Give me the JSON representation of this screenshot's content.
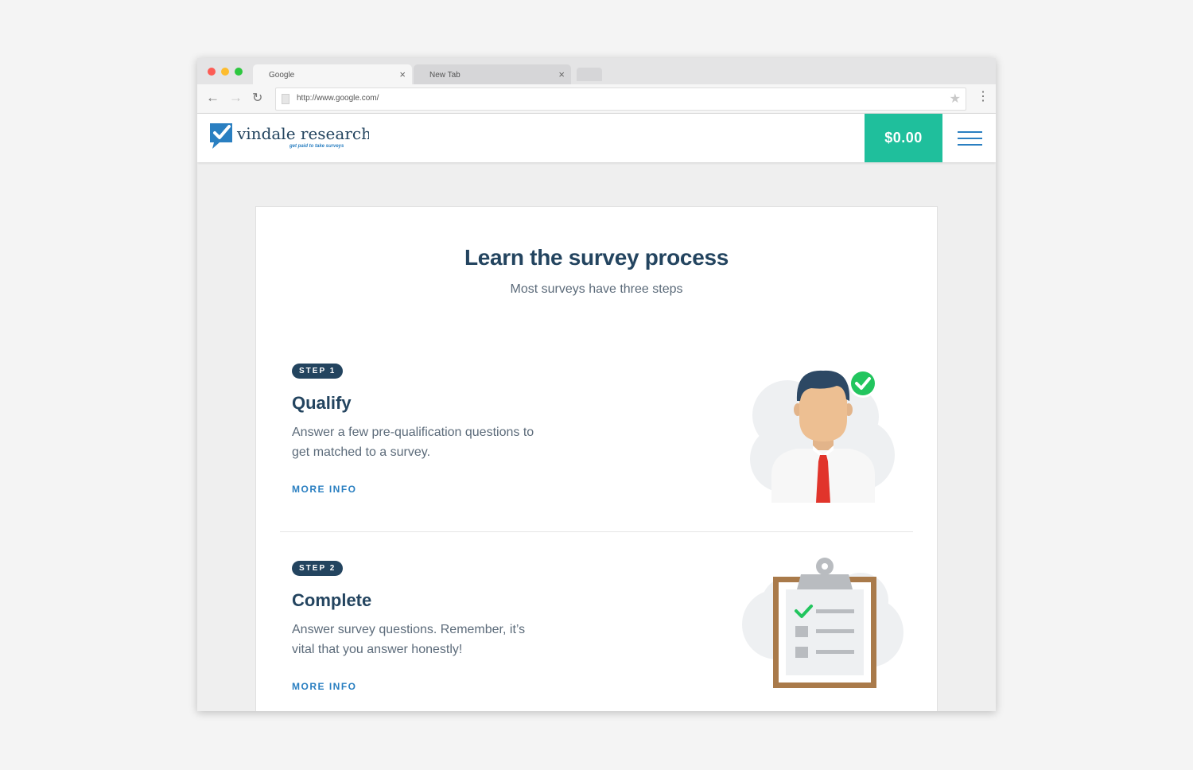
{
  "browser": {
    "tabs": [
      {
        "title": "Google",
        "close": "×"
      },
      {
        "title": "New Tab",
        "close": "×"
      }
    ],
    "url": "http://www.google.com/",
    "icons": {
      "back": "arrow-left-icon",
      "forward": "arrow-right-icon",
      "reload": "reload-icon",
      "bookmark": "star-icon",
      "menu": "kebab-menu-icon"
    }
  },
  "header": {
    "logo_name": "vindale research",
    "logo_tagline": "get paid to take surveys",
    "balance": "$0.00"
  },
  "main": {
    "title": "Learn the survey process",
    "subtitle": "Most surveys have three steps",
    "steps": [
      {
        "badge": "STEP 1",
        "title": "Qualify",
        "description": "Answer a few pre-qualification questions to get matched to a survey.",
        "link": "MORE INFO"
      },
      {
        "badge": "STEP 2",
        "title": "Complete",
        "description": "Answer survey questions. Remember, it’s vital that you answer honestly!",
        "link": "MORE INFO"
      }
    ]
  },
  "colors": {
    "accent": "#1fbf9c",
    "navy": "#23445f",
    "link": "#2a7fc1",
    "check": "#22c55e",
    "tie": "#e1342b"
  }
}
